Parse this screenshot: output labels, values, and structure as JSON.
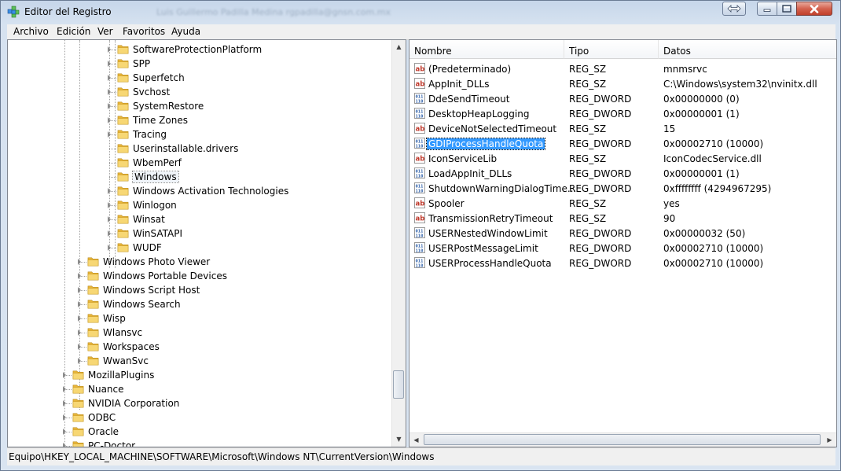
{
  "window": {
    "title": "Editor del Registro",
    "blurred_user": "Luis Guillermo Padilla Medina  rgpadilla@gnsn.com.mx"
  },
  "menu": [
    "Archivo",
    "Edición",
    "Ver",
    "Favoritos",
    "Ayuda"
  ],
  "tree": {
    "items": [
      {
        "label": "SoftwareProtectionPlatform",
        "level": 3,
        "expander": true
      },
      {
        "label": "SPP",
        "level": 3,
        "expander": true
      },
      {
        "label": "Superfetch",
        "level": 3,
        "expander": true
      },
      {
        "label": "Svchost",
        "level": 3,
        "expander": true
      },
      {
        "label": "SystemRestore",
        "level": 3,
        "expander": true
      },
      {
        "label": "Time Zones",
        "level": 3,
        "expander": true
      },
      {
        "label": "Tracing",
        "level": 3,
        "expander": true
      },
      {
        "label": "Userinstallable.drivers",
        "level": 3,
        "expander": false
      },
      {
        "label": "WbemPerf",
        "level": 3,
        "expander": false
      },
      {
        "label": "Windows",
        "level": 3,
        "expander": false,
        "selected": true
      },
      {
        "label": "Windows Activation Technologies",
        "level": 3,
        "expander": true
      },
      {
        "label": "Winlogon",
        "level": 3,
        "expander": true
      },
      {
        "label": "Winsat",
        "level": 3,
        "expander": true
      },
      {
        "label": "WinSATAPI",
        "level": 3,
        "expander": true
      },
      {
        "label": "WUDF",
        "level": 3,
        "expander": true
      },
      {
        "label": "Windows Photo Viewer",
        "level": 2,
        "expander": true
      },
      {
        "label": "Windows Portable Devices",
        "level": 2,
        "expander": true
      },
      {
        "label": "Windows Script Host",
        "level": 2,
        "expander": true
      },
      {
        "label": "Windows Search",
        "level": 2,
        "expander": true
      },
      {
        "label": "Wisp",
        "level": 2,
        "expander": true
      },
      {
        "label": "Wlansvc",
        "level": 2,
        "expander": true
      },
      {
        "label": "Workspaces",
        "level": 2,
        "expander": true
      },
      {
        "label": "WwanSvc",
        "level": 2,
        "expander": true
      },
      {
        "label": "MozillaPlugins",
        "level": 1,
        "expander": true
      },
      {
        "label": "Nuance",
        "level": 1,
        "expander": true
      },
      {
        "label": "NVIDIA Corporation",
        "level": 1,
        "expander": true
      },
      {
        "label": "ODBC",
        "level": 1,
        "expander": true
      },
      {
        "label": "Oracle",
        "level": 1,
        "expander": true
      },
      {
        "label": "PC-Doctor",
        "level": 1,
        "expander": true
      }
    ]
  },
  "list": {
    "columns": [
      "Nombre",
      "Tipo",
      "Datos"
    ],
    "rows": [
      {
        "name": "(Predeterminado)",
        "type": "REG_SZ",
        "data": "mnmsrvc",
        "icon": "string-value-icon"
      },
      {
        "name": "AppInit_DLLs",
        "type": "REG_SZ",
        "data": "C:\\Windows\\system32\\nvinitx.dll",
        "icon": "string-value-icon"
      },
      {
        "name": "DdeSendTimeout",
        "type": "REG_DWORD",
        "data": "0x00000000 (0)",
        "icon": "dword-value-icon"
      },
      {
        "name": "DesktopHeapLogging",
        "type": "REG_DWORD",
        "data": "0x00000001 (1)",
        "icon": "dword-value-icon"
      },
      {
        "name": "DeviceNotSelectedTimeout",
        "type": "REG_SZ",
        "data": "15",
        "icon": "string-value-icon"
      },
      {
        "name": "GDIProcessHandleQuota",
        "type": "REG_DWORD",
        "data": "0x00002710 (10000)",
        "icon": "dword-value-icon",
        "selected": true
      },
      {
        "name": "IconServiceLib",
        "type": "REG_SZ",
        "data": "IconCodecService.dll",
        "icon": "string-value-icon"
      },
      {
        "name": "LoadAppInit_DLLs",
        "type": "REG_DWORD",
        "data": "0x00000001 (1)",
        "icon": "dword-value-icon"
      },
      {
        "name": "ShutdownWarningDialogTime...",
        "type": "REG_DWORD",
        "data": "0xffffffff (4294967295)",
        "icon": "dword-value-icon"
      },
      {
        "name": "Spooler",
        "type": "REG_SZ",
        "data": "yes",
        "icon": "string-value-icon"
      },
      {
        "name": "TransmissionRetryTimeout",
        "type": "REG_SZ",
        "data": "90",
        "icon": "string-value-icon"
      },
      {
        "name": "USERNestedWindowLimit",
        "type": "REG_DWORD",
        "data": "0x00000032 (50)",
        "icon": "dword-value-icon"
      },
      {
        "name": "USERPostMessageLimit",
        "type": "REG_DWORD",
        "data": "0x00002710 (10000)",
        "icon": "dword-value-icon"
      },
      {
        "name": "USERProcessHandleQuota",
        "type": "REG_DWORD",
        "data": "0x00002710 (10000)",
        "icon": "dword-value-icon"
      }
    ]
  },
  "status": {
    "path": "Equipo\\HKEY_LOCAL_MACHINE\\SOFTWARE\\Microsoft\\Windows NT\\CurrentVersion\\Windows"
  },
  "colors": {
    "selection": "#3399ff",
    "folder": "#f2c94c",
    "string_icon": "#c0392b",
    "dword_icon": "#2b5ea8"
  }
}
